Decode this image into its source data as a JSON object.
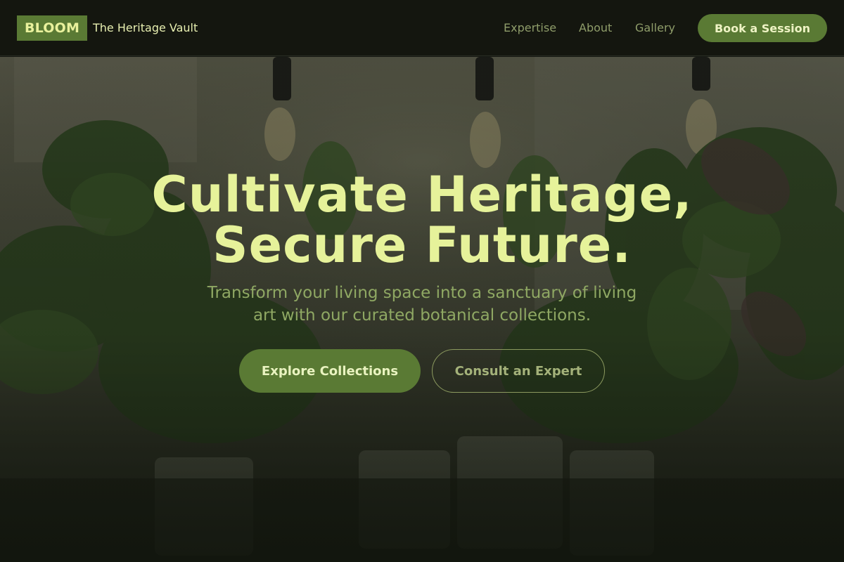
{
  "header": {
    "logo": "BLOOM",
    "brand_name": "The Heritage Vault",
    "nav": [
      {
        "label": "Expertise"
      },
      {
        "label": "About"
      },
      {
        "label": "Gallery"
      }
    ],
    "cta_label": "Book a Session"
  },
  "hero": {
    "headline_line1": "Cultivate Heritage,",
    "headline_line2": "Secure Future.",
    "subtitle_line1": "Transform your living space into a sanctuary of living",
    "subtitle_line2": "art with our curated botanical collections.",
    "primary_button": "Explore Collections",
    "secondary_button": "Consult an Expert"
  },
  "colors": {
    "accent": "#5a7a34",
    "headline": "#e6f29a",
    "background": "#141611"
  }
}
